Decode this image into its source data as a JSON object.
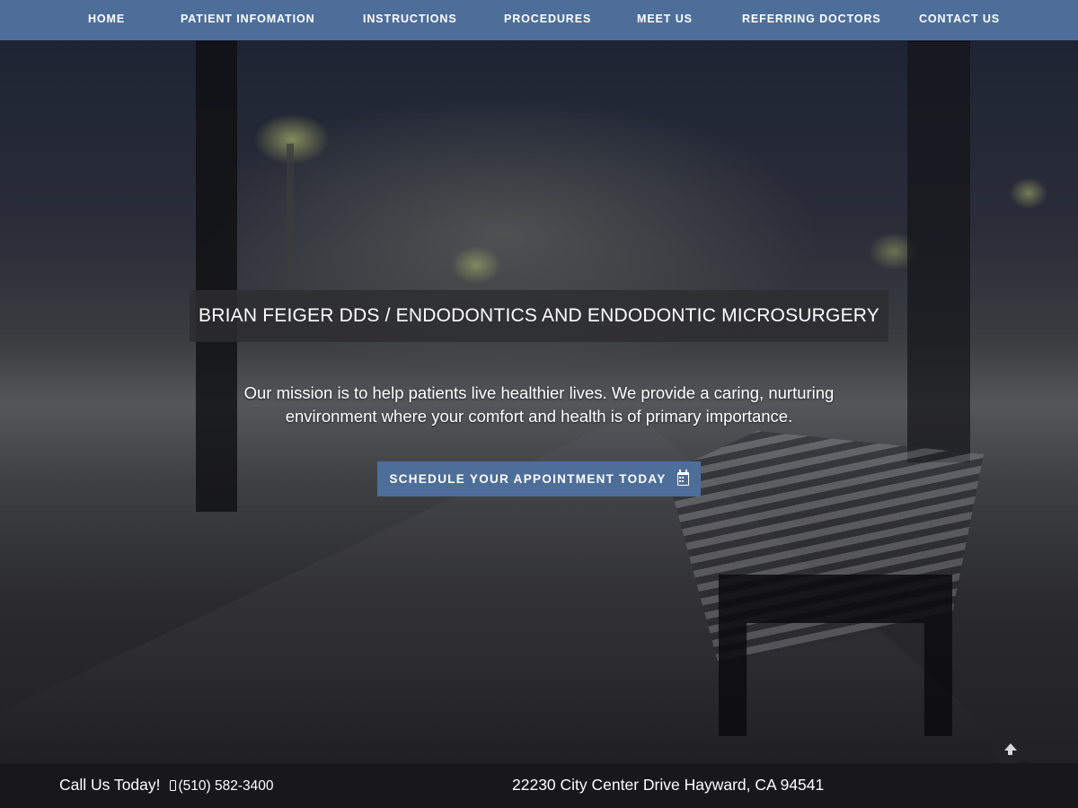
{
  "nav": {
    "items": [
      {
        "label": "HOME"
      },
      {
        "label": "PATIENT INFOMATION"
      },
      {
        "label": "INSTRUCTIONS"
      },
      {
        "label": "PROCEDURES"
      },
      {
        "label": "MEET US"
      },
      {
        "label": "REFERRING DOCTORS"
      },
      {
        "label": "CONTACT US"
      }
    ]
  },
  "hero": {
    "title": "BRIAN FEIGER DDS / ENDODONTICS AND ENDODONTIC MICROSURGERY",
    "mission": "Our mission is to help patients live healthier lives. We provide a caring, nurturing environment where your comfort and health is of primary importance.",
    "cta_label": "SCHEDULE YOUR APPOINTMENT TODAY",
    "cta_icon": "calendar-icon"
  },
  "scroll_top": {
    "icon": "arrow-up-icon"
  },
  "footer": {
    "call_label": "Call Us Today!",
    "phone_icon": "mobile-phone-icon",
    "phone": "(510) 582-3400",
    "address": "22230 City Center Drive Hayward, CA 94541"
  },
  "colors": {
    "nav_background": "#4e6e9a",
    "cta_background": "#4e6e9a",
    "footer_background": "#18181a",
    "text": "#ffffff"
  }
}
